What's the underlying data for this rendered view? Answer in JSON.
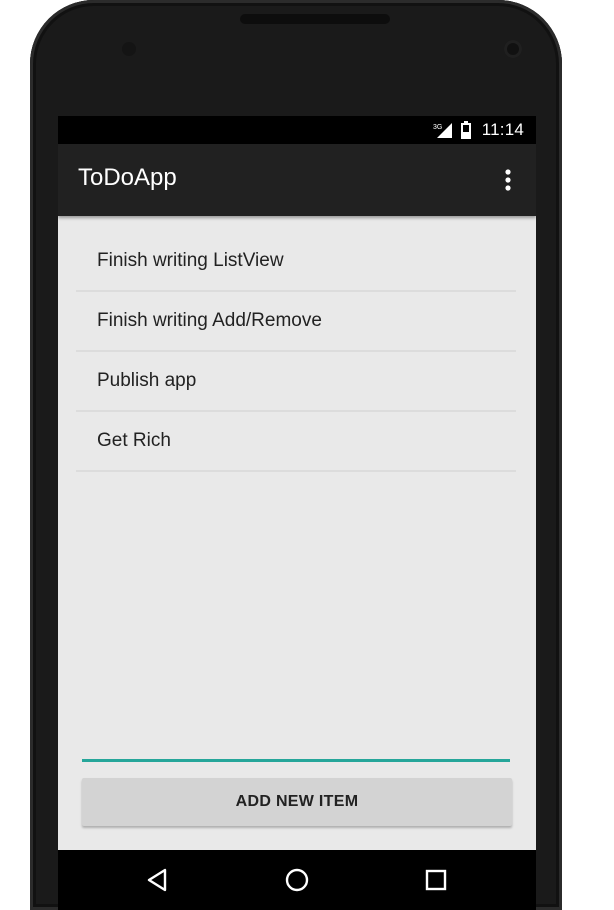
{
  "status_bar": {
    "time": "11:14",
    "signal_icon": "cell-signal-icon",
    "battery_icon": "battery-icon"
  },
  "app_bar": {
    "title": "ToDoApp",
    "overflow_icon": "overflow-menu-icon"
  },
  "todo_items": [
    {
      "label": "Finish writing ListView"
    },
    {
      "label": "Finish writing Add/Remove"
    },
    {
      "label": "Publish app"
    },
    {
      "label": "Get Rich"
    }
  ],
  "new_item": {
    "value": "",
    "placeholder": "",
    "button_label": "ADD NEW ITEM"
  },
  "nav_bar": {
    "back_icon": "back-triangle-icon",
    "home_icon": "home-circle-icon",
    "recents_icon": "recents-square-icon"
  },
  "colors": {
    "accent": "#26a69a",
    "app_bar": "#212121",
    "background": "#e9e9e9",
    "button": "#d3d3d3"
  }
}
